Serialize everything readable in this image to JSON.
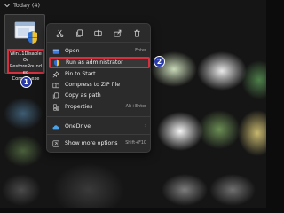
{
  "section": {
    "label": "Today (4)"
  },
  "file": {
    "name_lines": [
      "Win11DisableOr",
      "RestoreRounded",
      "Corners.exe"
    ]
  },
  "badges": [
    "1",
    "2"
  ],
  "toolbar": {
    "icons": [
      "cut-icon",
      "copy-icon",
      "rename-icon",
      "share-icon",
      "delete-icon"
    ]
  },
  "menu": {
    "items": [
      {
        "label": "Open",
        "shortcut": "Enter",
        "icon": "open-icon"
      },
      {
        "label": "Run as administrator",
        "shortcut": "",
        "icon": "shield-icon"
      },
      {
        "label": "Pin to Start",
        "shortcut": "",
        "icon": "pin-icon"
      },
      {
        "label": "Compress to ZIP file",
        "shortcut": "",
        "icon": "zip-icon"
      },
      {
        "label": "Copy as path",
        "shortcut": "",
        "icon": "copy-path-icon"
      },
      {
        "label": "Properties",
        "shortcut": "Alt+Enter",
        "icon": "properties-icon"
      },
      {
        "label": "OneDrive",
        "shortcut": "›",
        "icon": "onedrive-icon"
      },
      {
        "label": "Show more options",
        "shortcut": "Shift+F10",
        "icon": "more-options-icon"
      }
    ]
  },
  "colors": {
    "highlight_border": "#d6303f",
    "badge_fill": "#2a3aa8",
    "menu_bg": "#2b2b2b"
  }
}
